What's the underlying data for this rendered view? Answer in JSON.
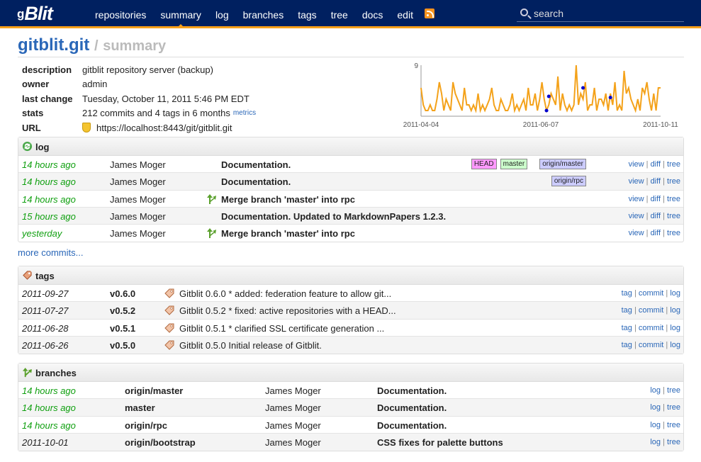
{
  "nav": {
    "logo": "Blit",
    "logo_prefix": "g",
    "items": [
      "repositories",
      "summary",
      "log",
      "branches",
      "tags",
      "tree",
      "docs",
      "edit"
    ],
    "active": "summary",
    "search_placeholder": "search"
  },
  "header": {
    "repo": "gitblit.git",
    "separator": "/",
    "page": "summary"
  },
  "meta": {
    "description_label": "description",
    "description": "gitblit repository server (backup)",
    "owner_label": "owner",
    "owner": "admin",
    "last_change_label": "last change",
    "last_change": "Tuesday, October 11, 2011 5:46 PM EDT",
    "stats_label": "stats",
    "stats": "212 commits and 4 tags in 6 months",
    "metrics_link": "metrics",
    "url_label": "URL",
    "url": "https://localhost:8443/git/gitblit.git"
  },
  "chart_data": {
    "type": "line",
    "title": "",
    "ylim": [
      0,
      9
    ],
    "y_tick_labels": [
      "9"
    ],
    "x_tick_labels": [
      "2011-04-04",
      "2011-06-07",
      "2011-10-11"
    ],
    "values": [
      5,
      2,
      1,
      1,
      2,
      1,
      1,
      3,
      6,
      4,
      1,
      3,
      2,
      1,
      6,
      4,
      3,
      2,
      1,
      5,
      2,
      2,
      1,
      2,
      1,
      4,
      1,
      2,
      1,
      2,
      3,
      5,
      2,
      1,
      1,
      3,
      2,
      1,
      1,
      2,
      4,
      1,
      2,
      1,
      2,
      3,
      1,
      5,
      2,
      2,
      4,
      1,
      3,
      6,
      3,
      1,
      2,
      4,
      3,
      2,
      7,
      1,
      4,
      2,
      1,
      2,
      1,
      2,
      9,
      2,
      4,
      3,
      6,
      1,
      2,
      2,
      5,
      1,
      3,
      3,
      2,
      4,
      1,
      4,
      2,
      6,
      1,
      2,
      1,
      8,
      4,
      5,
      3,
      2,
      1,
      3,
      1,
      5,
      4,
      6,
      3,
      1,
      4,
      1,
      5,
      5
    ],
    "highlight_points": [
      [
        56,
        3.5
      ],
      [
        55,
        1
      ],
      [
        71,
        5
      ],
      [
        83,
        3.3
      ]
    ],
    "series_color": "#f4a21a",
    "point_color": "#0000cc"
  },
  "log": {
    "title": "log",
    "rows": [
      {
        "age": "14 hours ago",
        "author": "James Moger",
        "message": "Documentation.",
        "merge": false,
        "refs": [
          "HEAD",
          "master",
          "origin/master"
        ]
      },
      {
        "age": "14 hours ago",
        "author": "James Moger",
        "message": "Documentation.",
        "merge": false,
        "refs": [
          "origin/rpc"
        ]
      },
      {
        "age": "14 hours ago",
        "author": "James Moger",
        "message": "Merge branch 'master' into rpc",
        "merge": true,
        "refs": []
      },
      {
        "age": "15 hours ago",
        "author": "James Moger",
        "message": "Documentation. Updated to MarkdownPapers 1.2.3.",
        "merge": false,
        "refs": []
      },
      {
        "age": "yesterday",
        "author": "James Moger",
        "message": "Merge branch 'master' into rpc",
        "merge": true,
        "refs": []
      }
    ],
    "links": [
      "view",
      "diff",
      "tree"
    ],
    "more": "more commits..."
  },
  "tags": {
    "title": "tags",
    "rows": [
      {
        "date": "2011-09-27",
        "name": "v0.6.0",
        "message": "Gitblit 0.6.0 * added: federation feature to allow git..."
      },
      {
        "date": "2011-07-27",
        "name": "v0.5.2",
        "message": "Gitblit 0.5.2 * fixed: active repositories with a HEAD..."
      },
      {
        "date": "2011-06-28",
        "name": "v0.5.1",
        "message": "Gitblit 0.5.1 * clarified SSL certificate generation ..."
      },
      {
        "date": "2011-06-26",
        "name": "v0.5.0",
        "message": "Gitblit 0.5.0 Initial release of Gitblit."
      }
    ],
    "links": [
      "tag",
      "commit",
      "log"
    ]
  },
  "branches": {
    "title": "branches",
    "rows": [
      {
        "age": "14 hours ago",
        "name": "origin/master",
        "author": "James Moger",
        "message": "Documentation."
      },
      {
        "age": "14 hours ago",
        "name": "master",
        "author": "James Moger",
        "message": "Documentation."
      },
      {
        "age": "14 hours ago",
        "name": "origin/rpc",
        "author": "James Moger",
        "message": "Documentation."
      },
      {
        "age": "2011-10-01",
        "name": "origin/bootstrap",
        "author": "James Moger",
        "message": "CSS fixes for palette buttons"
      }
    ],
    "links": [
      "log",
      "tree"
    ]
  },
  "colors": {
    "nav_bg": "#002060",
    "accent": "#f7a11a",
    "link": "#2a67b8",
    "age_green": "#11a011",
    "ref_head": "#ff99ff",
    "ref_local": "#ccffcc",
    "ref_remote": "#ccccff"
  }
}
